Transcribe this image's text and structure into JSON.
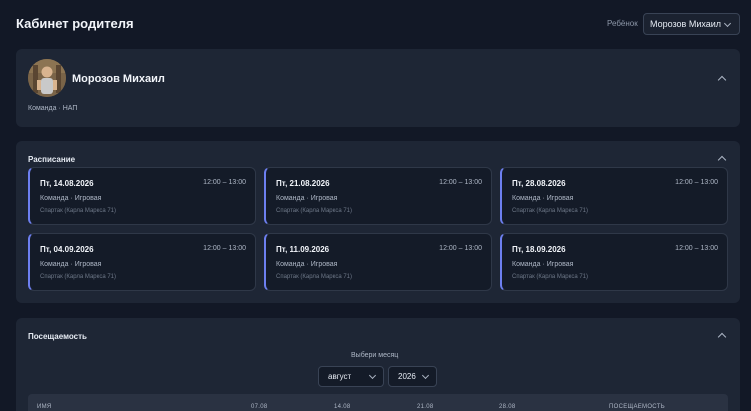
{
  "header": {
    "title": "Кабинет родителя",
    "child_label": "Ребёнок",
    "child_selected": "Морозов Михаил"
  },
  "profile": {
    "name": "Морозов Михаил",
    "team_line": "Команда · НАП"
  },
  "schedule": {
    "title": "Расписание",
    "slots": [
      {
        "date": "Пт, 14.08.2026",
        "time": "12:00 – 13:00",
        "team": "Команда · Игровая",
        "place": "Спартак (Карла Маркса 71)"
      },
      {
        "date": "Пт, 21.08.2026",
        "time": "12:00 – 13:00",
        "team": "Команда · Игровая",
        "place": "Спартак (Карла Маркса 71)"
      },
      {
        "date": "Пт, 28.08.2026",
        "time": "12:00 – 13:00",
        "team": "Команда · Игровая",
        "place": "Спартак (Карла Маркса 71)"
      },
      {
        "date": "Пт, 04.09.2026",
        "time": "12:00 – 13:00",
        "team": "Команда · Игровая",
        "place": "Спартак (Карла Маркса 71)"
      },
      {
        "date": "Пт, 11.09.2026",
        "time": "12:00 – 13:00",
        "team": "Команда · Игровая",
        "place": "Спартак (Карла Маркса 71)"
      },
      {
        "date": "Пт, 18.09.2026",
        "time": "12:00 – 13:00",
        "team": "Команда · Игровая",
        "place": "Спартак (Карла Маркса 71)"
      }
    ]
  },
  "attendance": {
    "title": "Посещаемость",
    "month_label": "Выбери месяц",
    "month": "август",
    "year": "2026",
    "columns": [
      "ИМЯ",
      "07.08",
      "14.08",
      "21.08",
      "28.08",
      "ПОСЕЩАЕМОСТЬ"
    ]
  }
}
